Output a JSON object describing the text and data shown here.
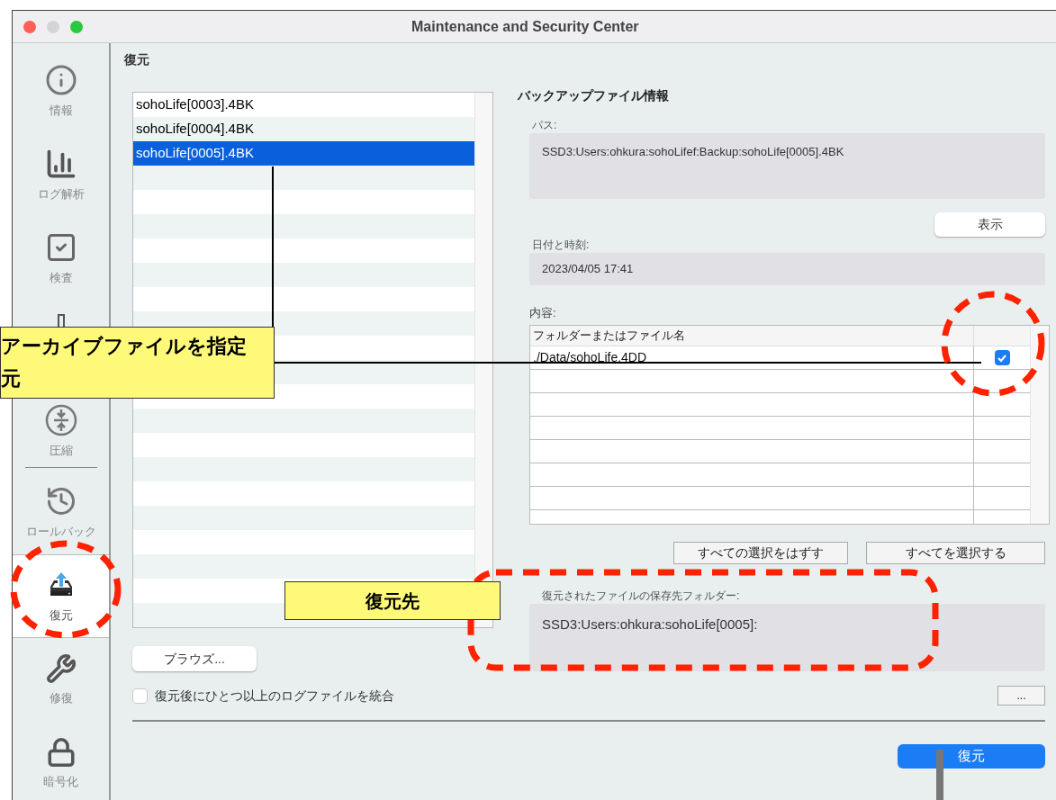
{
  "window": {
    "title": "Maintenance and Security Center"
  },
  "sidebar": {
    "items": [
      {
        "kind": "item",
        "label": "情報",
        "selected": false
      },
      {
        "kind": "item",
        "label": "ログ解析",
        "selected": false
      },
      {
        "kind": "item",
        "label": "検査",
        "selected": false
      },
      {
        "kind": "item"
      },
      {
        "kind": "item",
        "label": "圧縮",
        "selected": false
      },
      {
        "kind": "divider"
      },
      {
        "kind": "item",
        "label": "ロールバック",
        "selected": false
      },
      {
        "kind": "item",
        "label": "復元",
        "selected": true
      },
      {
        "kind": "item",
        "label": "修復",
        "selected": false
      },
      {
        "kind": "item",
        "label": "暗号化",
        "selected": false
      }
    ]
  },
  "page_title": "復元",
  "backup_list": {
    "items": [
      {
        "label": "sohoLife[0003].4BK",
        "selected": false
      },
      {
        "label": "sohoLife[0004].4BK",
        "selected": false
      },
      {
        "label": "sohoLife[0005].4BK",
        "selected": true
      }
    ]
  },
  "browse_button": "ブラウズ...",
  "merge_logs": {
    "label": "復元後にひとつ以上のログファイルを統合",
    "checked": false
  },
  "info": {
    "heading": "バックアップファイル情報",
    "path_label": "パス:",
    "path": "SSD3:Users:ohkura:sohoLifef:Backup:sohoLife[0005].4BK",
    "show_button": "表示",
    "date_label": "日付と時刻:",
    "date": "2023/04/05 17:41",
    "contents_label": "内容:",
    "table": {
      "columns": [
        "フォルダーまたはファイル名"
      ],
      "rows": [
        {
          "name": "./Data/sohoLife.4DD",
          "checked": true
        }
      ]
    },
    "deselect_all_button": "すべての選択をはずす",
    "select_all_button": "すべてを選択する",
    "destination_label": "復元されたファイルの保存先フォルダー:",
    "destination": "SSD3:Users:ohkura:sohoLife[0005]:",
    "choose_button": "..."
  },
  "restore_button": "復元",
  "annotations": {
    "callouts": [
      {
        "lines": [
          "アーカイブファイルを指定",
          "元"
        ]
      },
      {
        "lines": [
          "復元先"
        ]
      }
    ]
  }
}
